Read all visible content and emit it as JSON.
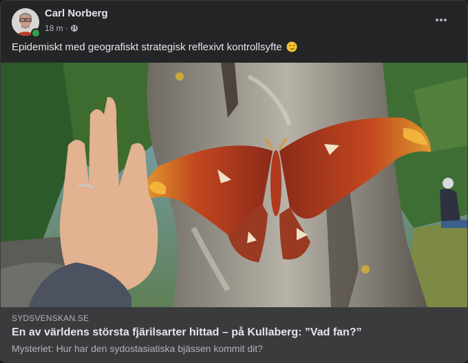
{
  "post": {
    "author": "Carl Norberg",
    "time": "18 m",
    "separator": "·",
    "audience_icon": "globe-icon",
    "menu_icon": "more-dots-icon",
    "caption": "Epidemiskt med geografiskt strategisk reflexivt kontrollsyfte",
    "caption_emoji": "smirk-emoji"
  },
  "link": {
    "domain": "SYDSVENSKAN.SE",
    "title": "En av världens största fjärilsarter hittad – på Kullaberg: ”Vad fan?”",
    "description": "Mysteriet: Hur har den sydostasiatiska bjässen kommit dit?"
  },
  "colors": {
    "card_bg": "#242526",
    "link_bg": "#3a3b3c",
    "primary_text": "#e4e6eb",
    "secondary_text": "#b0b3b8",
    "online": "#31a24c"
  }
}
